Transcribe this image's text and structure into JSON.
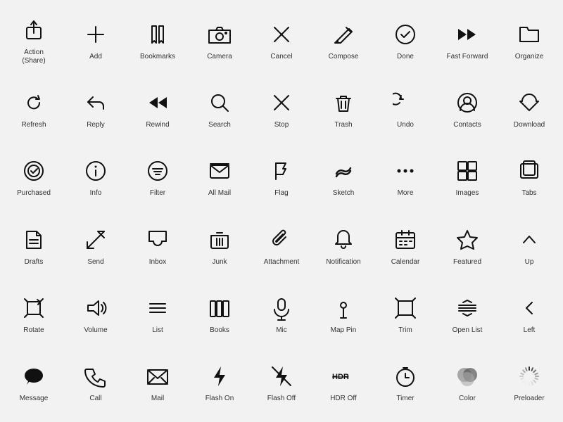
{
  "icons": [
    {
      "name": "action-share",
      "label": "Action\n(Share)",
      "symbol": "action"
    },
    {
      "name": "add",
      "label": "Add",
      "symbol": "add"
    },
    {
      "name": "bookmarks",
      "label": "Bookmarks",
      "symbol": "bookmarks"
    },
    {
      "name": "camera",
      "label": "Camera",
      "symbol": "camera"
    },
    {
      "name": "cancel",
      "label": "Cancel",
      "symbol": "cancel"
    },
    {
      "name": "compose",
      "label": "Compose",
      "symbol": "compose"
    },
    {
      "name": "done",
      "label": "Done",
      "symbol": "done"
    },
    {
      "name": "fast-forward",
      "label": "Fast Forward",
      "symbol": "fastforward"
    },
    {
      "name": "organize",
      "label": "Organize",
      "symbol": "organize"
    },
    {
      "name": "refresh",
      "label": "Refresh",
      "symbol": "refresh"
    },
    {
      "name": "reply",
      "label": "Reply",
      "symbol": "reply"
    },
    {
      "name": "rewind",
      "label": "Rewind",
      "symbol": "rewind"
    },
    {
      "name": "search",
      "label": "Search",
      "symbol": "search"
    },
    {
      "name": "stop",
      "label": "Stop",
      "symbol": "stop"
    },
    {
      "name": "trash",
      "label": "Trash",
      "symbol": "trash"
    },
    {
      "name": "undo",
      "label": "Undo",
      "symbol": "undo"
    },
    {
      "name": "contacts",
      "label": "Contacts",
      "symbol": "contacts"
    },
    {
      "name": "download",
      "label": "Download",
      "symbol": "download"
    },
    {
      "name": "purchased",
      "label": "Purchased",
      "symbol": "purchased"
    },
    {
      "name": "info",
      "label": "Info",
      "symbol": "info"
    },
    {
      "name": "filter",
      "label": "Filter",
      "symbol": "filter"
    },
    {
      "name": "all-mail",
      "label": "All Mail",
      "symbol": "allmail"
    },
    {
      "name": "flag",
      "label": "Flag",
      "symbol": "flag"
    },
    {
      "name": "sketch",
      "label": "Sketch",
      "symbol": "sketch"
    },
    {
      "name": "more",
      "label": "More",
      "symbol": "more"
    },
    {
      "name": "images",
      "label": "Images",
      "symbol": "images"
    },
    {
      "name": "tabs",
      "label": "Tabs",
      "symbol": "tabs"
    },
    {
      "name": "drafts",
      "label": "Drafts",
      "symbol": "drafts"
    },
    {
      "name": "send",
      "label": "Send",
      "symbol": "send"
    },
    {
      "name": "inbox",
      "label": "Inbox",
      "symbol": "inbox"
    },
    {
      "name": "junk",
      "label": "Junk",
      "symbol": "junk"
    },
    {
      "name": "attachment",
      "label": "Attachment",
      "symbol": "attachment"
    },
    {
      "name": "notification",
      "label": "Notification",
      "symbol": "notification"
    },
    {
      "name": "calendar",
      "label": "Calendar",
      "symbol": "calendar"
    },
    {
      "name": "featured",
      "label": "Featured",
      "symbol": "featured"
    },
    {
      "name": "up",
      "label": "Up",
      "symbol": "up"
    },
    {
      "name": "rotate",
      "label": "Rotate",
      "symbol": "rotate"
    },
    {
      "name": "volume",
      "label": "Volume",
      "symbol": "volume"
    },
    {
      "name": "list",
      "label": "List",
      "symbol": "list"
    },
    {
      "name": "books",
      "label": "Books",
      "symbol": "books"
    },
    {
      "name": "mic",
      "label": "Mic",
      "symbol": "mic"
    },
    {
      "name": "map-pin",
      "label": "Map Pin",
      "symbol": "mappin"
    },
    {
      "name": "trim",
      "label": "Trim",
      "symbol": "trim"
    },
    {
      "name": "open-list",
      "label": "Open List",
      "symbol": "openlist"
    },
    {
      "name": "left",
      "label": "Left",
      "symbol": "left"
    },
    {
      "name": "message",
      "label": "Message",
      "symbol": "message"
    },
    {
      "name": "call",
      "label": "Call",
      "symbol": "call"
    },
    {
      "name": "mail",
      "label": "Mail",
      "symbol": "mail"
    },
    {
      "name": "flash-on",
      "label": "Flash On",
      "symbol": "flashon"
    },
    {
      "name": "flash-off",
      "label": "Flash Off",
      "symbol": "flashoff"
    },
    {
      "name": "hdr-off",
      "label": "HDR Off",
      "symbol": "hdroff"
    },
    {
      "name": "timer",
      "label": "Timer",
      "symbol": "timer"
    },
    {
      "name": "color",
      "label": "Color",
      "symbol": "color"
    },
    {
      "name": "preloader",
      "label": "Preloader",
      "symbol": "preloader"
    }
  ]
}
